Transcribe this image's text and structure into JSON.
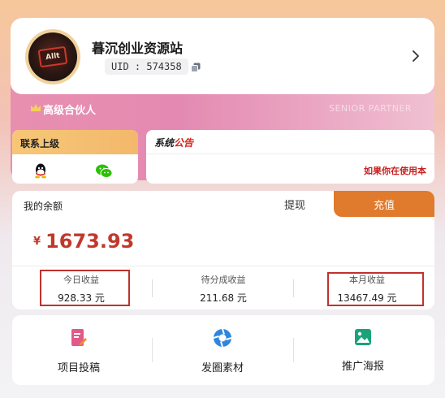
{
  "profile": {
    "site_name": "暮沉创业资源站",
    "uid": "UID : 574358",
    "avatar_text": "Allt",
    "partner_label": "高级合伙人",
    "partner_en": "SENIOR PARTNER"
  },
  "contact": {
    "title": "联系上级",
    "icons": [
      "qq-icon",
      "wechat-icon"
    ]
  },
  "notice": {
    "title_black": "系统",
    "title_red": "公告",
    "marquee": "如果你在使用本"
  },
  "balance": {
    "label": "我的余额",
    "withdraw": "提现",
    "recharge": "充值",
    "currency": "¥",
    "amount": "1673.93"
  },
  "stats": [
    {
      "label": "今日收益",
      "value": "928.33 元"
    },
    {
      "label": "待分成收益",
      "value": "211.68 元"
    },
    {
      "label": "本月收益",
      "value": "13467.49 元"
    }
  ],
  "actions": [
    {
      "label": "项目投稿",
      "icon": "edit-document-icon"
    },
    {
      "label": "发圈素材",
      "icon": "aperture-icon"
    },
    {
      "label": "推广海报",
      "icon": "image-icon"
    }
  ],
  "colors": {
    "accent_orange": "#e07a2c",
    "amount_red": "#c0392b",
    "highlight_red": "#c0322c",
    "partner_pink": "#e48ab2"
  }
}
